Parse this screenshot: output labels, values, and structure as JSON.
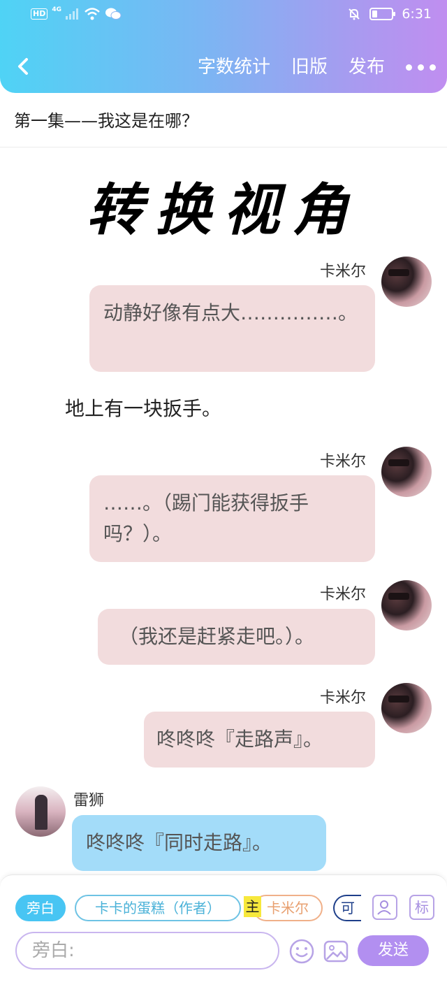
{
  "status_bar": {
    "hd_label": "HD",
    "network_label": "4G",
    "time": "6:31"
  },
  "header": {
    "word_count": "字数统计",
    "old_version": "旧版",
    "publish": "发布"
  },
  "chapter_title": "第一集——我这是在哪？",
  "big_heading": "转换视角",
  "messages": [
    {
      "sender": "卡米尔",
      "text": "动静好像有点大……………。"
    },
    {
      "narration": "地上有一块扳手。"
    },
    {
      "sender": "卡米尔",
      "text": "……。（踢门能获得扳手吗？）。"
    },
    {
      "sender": "卡米尔",
      "text": "（我还是赶紧走吧。）。"
    },
    {
      "sender": "卡米尔",
      "text": "咚咚咚『走路声』。"
    },
    {
      "sender": "雷狮",
      "text": "咚咚咚『同时走路』。"
    }
  ],
  "bottom": {
    "chips": {
      "narration": "旁白",
      "author": "卡卡的蛋糕（作者）",
      "main_tag": "主",
      "kamil": "卡米尔",
      "more": "可"
    },
    "tools": {
      "role": "role-icon",
      "mark": "标"
    },
    "input_placeholder": "旁白:",
    "send": "发送"
  },
  "colors": {
    "header_gradient_start": "#4fd3f5",
    "header_gradient_end": "#c08ef0",
    "bubble_pink": "#f2dcdd",
    "bubble_blue": "#a3dcf9",
    "send_button": "#b28ff0"
  }
}
